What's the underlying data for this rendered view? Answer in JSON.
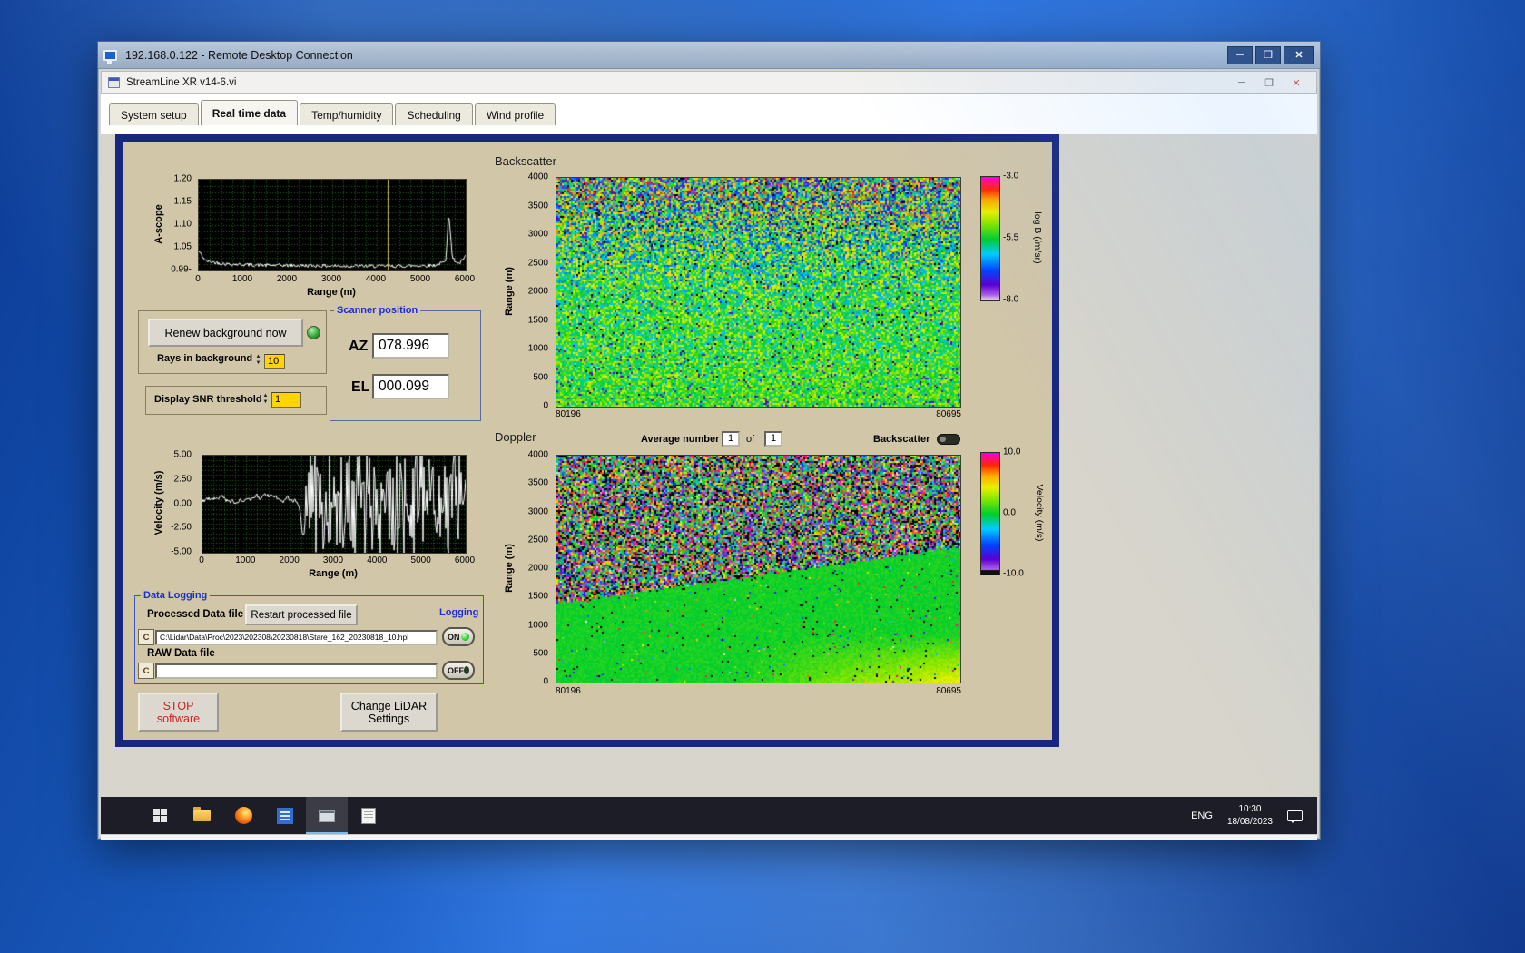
{
  "rdp": {
    "title": "192.168.0.122 - Remote Desktop Connection"
  },
  "app": {
    "title": "StreamLine XR v14-6.vi",
    "tabs": [
      {
        "label": "System setup"
      },
      {
        "label": "Real time data"
      },
      {
        "label": "Temp/humidity"
      },
      {
        "label": "Scheduling"
      },
      {
        "label": "Wind profile"
      }
    ]
  },
  "panel": {
    "backscatter_title": "Backscatter",
    "doppler_title": "Doppler",
    "renew_button": "Renew background now",
    "rays_label": "Rays in background",
    "rays_value": "10",
    "snr_label": "Display SNR threshold",
    "snr_value": "1",
    "scanner": {
      "title": "Scanner position",
      "az_label": "AZ",
      "az_value": "078.996",
      "el_label": "EL",
      "el_value": "000.099"
    },
    "average": {
      "label": "Average number",
      "value": "1",
      "of": "of",
      "value2": "1"
    },
    "backscatter_toggle_label": "Backscatter",
    "logging": {
      "group_label": "Data Logging",
      "processed_label": "Processed Data file",
      "restart_button": "Restart processed file",
      "logging_label": "Logging",
      "drive_icon": "C",
      "processed_path": "C:\\Lidar\\Data\\Proc\\2023\\202308\\20230818\\Stare_162_20230818_10.hpl",
      "raw_label": "RAW Data file",
      "raw_path": "",
      "on_label": "ON",
      "off_label": "OFF"
    },
    "stop_button_line1": "STOP",
    "stop_button_line2": "software",
    "change_button_line1": "Change LiDAR",
    "change_button_line2": "Settings"
  },
  "taskbar": {
    "lang": "ENG",
    "time": "10:30",
    "date": "18/08/2023"
  },
  "colors": {
    "accent_blue": "#1a2fd0",
    "panel_tan": "#d2c6a9",
    "frame_navy": "#18267e",
    "stop_red": "#c62420"
  },
  "chart_data": {
    "ascope": {
      "type": "line",
      "xlabel": "Range (m)",
      "ylabel": "A-scope",
      "xlim": [
        0,
        6000
      ],
      "ylim": [
        0.99,
        1.2
      ],
      "x_ticks": [
        "0",
        "1000",
        "2000",
        "3000",
        "4000",
        "5000",
        "6000"
      ],
      "y_ticks": [
        "1.20",
        "1.15",
        "1.10",
        "1.05",
        "0.99-"
      ],
      "cursor_x": 4250,
      "anchors": [
        [
          0,
          1.035
        ],
        [
          150,
          1.012
        ],
        [
          600,
          1.005
        ],
        [
          1500,
          1.002
        ],
        [
          2500,
          1.001
        ],
        [
          3500,
          1.0
        ],
        [
          4500,
          1.0
        ],
        [
          5300,
          1.002
        ],
        [
          5550,
          1.01
        ],
        [
          5620,
          1.128
        ],
        [
          5700,
          1.018
        ],
        [
          5850,
          1.005
        ],
        [
          6000,
          1.022
        ]
      ],
      "noise": 0.004,
      "seed": 42,
      "grid": true
    },
    "velocity": {
      "type": "line",
      "xlabel": "Range (m)",
      "ylabel": "Velocity (m/s)",
      "xlim": [
        0,
        6000
      ],
      "ylim": [
        -5,
        5
      ],
      "x_ticks": [
        "0",
        "1000",
        "2000",
        "3000",
        "4000",
        "5000",
        "6000"
      ],
      "y_ticks": [
        "5.00",
        "2.50",
        "0.00",
        "-2.50",
        "-5.00"
      ],
      "calm_until": 2350,
      "calm_mean": 0.4,
      "calm_noise": 0.8,
      "dip_x": 2300,
      "dip_depth": 3.2,
      "seed": 9,
      "grid": true
    },
    "backscatter": {
      "type": "heatmap",
      "ylabel": "Range (m)",
      "ylim": [
        0,
        4000
      ],
      "y_ticks": [
        "4000",
        "3500",
        "3000",
        "2500",
        "2000",
        "1500",
        "1000",
        "500",
        "0"
      ],
      "x_start_label": "80196",
      "x_end_label": "80695",
      "value_range": [
        -8.0,
        -3.0
      ],
      "colorbar": {
        "ticks": [
          "-3.0",
          "-5.5",
          "-8.0"
        ],
        "label": "log B (/m/sr)"
      },
      "seed": 7
    },
    "doppler": {
      "type": "heatmap",
      "ylabel": "Range (m)",
      "ylim": [
        0,
        4000
      ],
      "y_ticks": [
        "4000",
        "3500",
        "3000",
        "2500",
        "2000",
        "1500",
        "1000",
        "500",
        "0"
      ],
      "x_start_label": "80196",
      "x_end_label": "80695",
      "value_range": [
        -10.0,
        10.0
      ],
      "colorbar": {
        "ticks": [
          "10.0",
          "0.0",
          "-10.0"
        ],
        "label": "Velocity (m/s)"
      },
      "seed": 13
    }
  }
}
